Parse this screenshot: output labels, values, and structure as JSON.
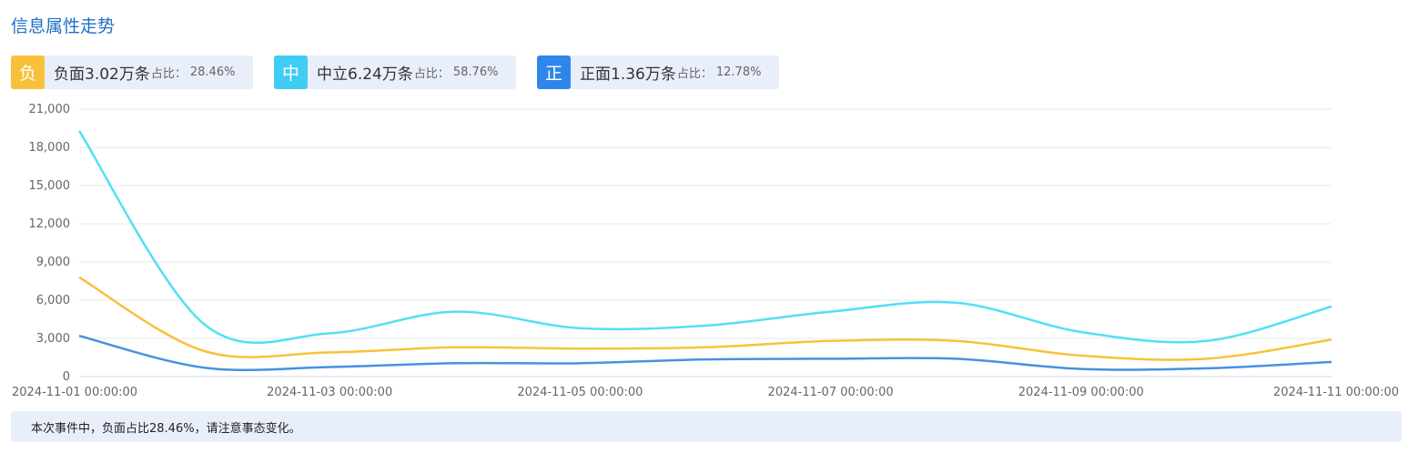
{
  "title": "信息属性走势",
  "badges": [
    {
      "icon": "负",
      "main": "负面3.02万条",
      "ratio_label": "占比：",
      "ratio": "28.46%",
      "color": "#f8c13a"
    },
    {
      "icon": "中",
      "main": "中立6.24万条",
      "ratio_label": "占比：",
      "ratio": "58.76%",
      "color": "#3fcdf3"
    },
    {
      "icon": "正",
      "main": "正面1.36万条",
      "ratio_label": "占比：",
      "ratio": "12.78%",
      "color": "#2f86ea"
    }
  ],
  "chart_data": {
    "type": "line",
    "x": [
      "2024-11-01 00:00:00",
      "2024-11-02 00:00:00",
      "2024-11-03 00:00:00",
      "2024-11-04 00:00:00",
      "2024-11-05 00:00:00",
      "2024-11-06 00:00:00",
      "2024-11-07 00:00:00",
      "2024-11-08 00:00:00",
      "2024-11-09 00:00:00",
      "2024-11-10 00:00:00",
      "2024-11-11 00:00:00"
    ],
    "x_tick_labels": [
      "2024-11-01 00:00:00",
      "2024-11-03 00:00:00",
      "2024-11-05 00:00:00",
      "2024-11-07 00:00:00",
      "2024-11-09 00:00:00",
      "2024-11-11 00:00:00"
    ],
    "y_ticks": [
      0,
      3000,
      6000,
      9000,
      12000,
      15000,
      18000,
      21000
    ],
    "y_tick_labels": [
      "0",
      "3,000",
      "6,000",
      "9,000",
      "12,000",
      "15,000",
      "18,000",
      "21,000"
    ],
    "ylim": [
      0,
      21000
    ],
    "grid": true,
    "series": [
      {
        "values": [
          7800,
          2000,
          1900,
          2300,
          2200,
          2300,
          2800,
          2800,
          1650,
          1400,
          2900
        ],
        "color": "#f8c13a"
      },
      {
        "values": [
          19300,
          4100,
          3400,
          5100,
          3800,
          4000,
          5100,
          5800,
          3500,
          2800,
          5500
        ],
        "color": "#52e0f5"
      },
      {
        "values": [
          3200,
          700,
          750,
          1050,
          1050,
          1350,
          1400,
          1400,
          600,
          650,
          1150
        ],
        "color": "#4692e0"
      }
    ]
  },
  "note": "本次事件中，负面占比28.46%，请注意事态变化。"
}
